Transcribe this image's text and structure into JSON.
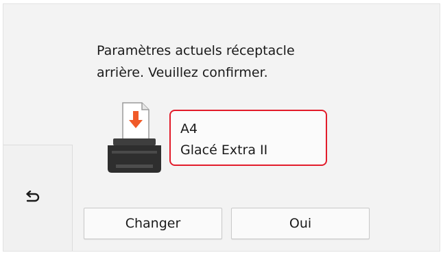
{
  "message": {
    "line1": "Paramètres actuels réceptacle",
    "line2": "arrière. Veuillez confirmer."
  },
  "paper": {
    "size": "A4",
    "type": "Glacé Extra II"
  },
  "buttons": {
    "change_label": "Changer",
    "confirm_label": "Oui"
  },
  "icons": {
    "back": "back-arrow-icon",
    "printer": "printer-rear-tray-icon"
  },
  "colors": {
    "highlight_border": "#e21b2a",
    "paper_arrow": "#f05a28"
  }
}
